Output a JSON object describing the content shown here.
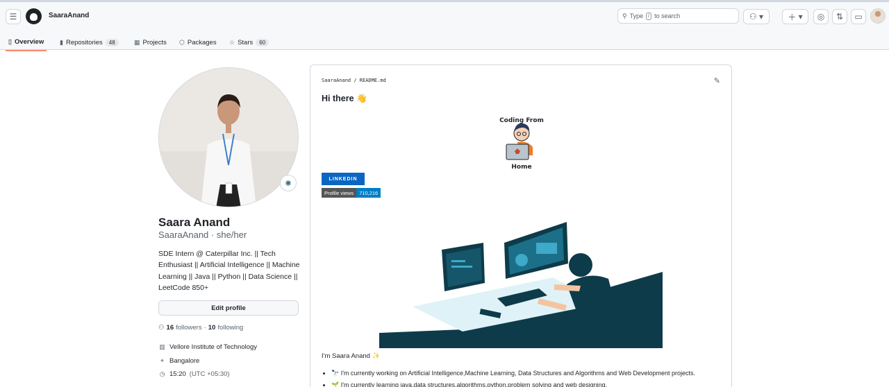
{
  "header": {
    "username": "SaaraAnand",
    "search_prefix": "Type",
    "search_key": "/",
    "search_suffix": "to search"
  },
  "tabs": [
    {
      "label": "Overview"
    },
    {
      "label": "Repositories",
      "count": "48"
    },
    {
      "label": "Projects"
    },
    {
      "label": "Packages"
    },
    {
      "label": "Stars",
      "count": "60"
    }
  ],
  "profile": {
    "name": "Saara Anand",
    "handle": "SaaraAnand · she/her",
    "bio": "SDE Intern @ Caterpillar Inc. || Tech Enthusiast || Artificial Intelligence || Machine Learning || Java || Python || Data Science || LeetCode 850+",
    "edit_label": "Edit profile",
    "followers_count": "16",
    "followers_label": "followers",
    "following_sep": "·",
    "following_count": "10",
    "following_label": "following",
    "organization": "Vellore Institute of Technology",
    "location": "Bangalore",
    "time": "15:20",
    "timezone": "(UTC +05:30)"
  },
  "readme": {
    "path": "SaaraAnand / README.md",
    "heading": "Hi there 👋",
    "coding_top": "Coding From",
    "coding_bottom": "Home",
    "linkedin_badge": "LINKEDIN",
    "views_label": "Profile views",
    "views_value": "710,216",
    "intro": "I'm Saara Anand ✨",
    "bullets": [
      "🔭 I'm currently working on Artificial Intelligence,Machine Learning, Data Structures and Algorithms and Web Development projects.",
      "🌱 I'm currently learning java,data structures,algorithms,python,problem solving and web designing."
    ]
  },
  "colors": {
    "accent_tab": "#fd8c73",
    "linkedin": "#0a66c2",
    "views": "#007ec6",
    "illustration_dark": "#0e3b4a"
  }
}
